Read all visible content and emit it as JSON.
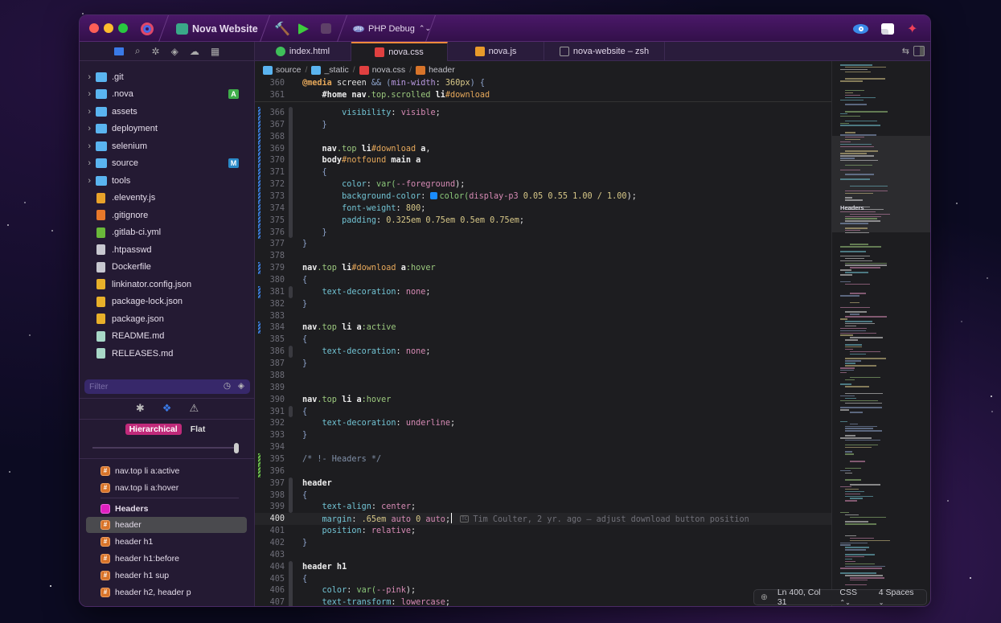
{
  "titlebar": {
    "project": "Nova Website",
    "scheme": "PHP Debug",
    "scheme_badge": "php"
  },
  "tabs": [
    {
      "label": "index.html",
      "icon": "globe-icon",
      "color": "#3fbf5a",
      "active": false
    },
    {
      "label": "nova.css",
      "icon": "css-nova-icon",
      "color": "#e04040",
      "active": true
    },
    {
      "label": "nova.js",
      "icon": "js-icon",
      "color": "#e89a2a",
      "active": false
    },
    {
      "label": "nova-website – zsh",
      "icon": "terminal-icon",
      "color": "#999999",
      "active": false
    }
  ],
  "breadcrumb": [
    "source",
    "_static",
    "nova.css",
    "header"
  ],
  "files": [
    {
      "name": ".git",
      "folder": true,
      "color": "#5ab4f0"
    },
    {
      "name": ".nova",
      "folder": true,
      "color": "#5ab4f0",
      "badge": "A",
      "badge_color": "#3fae4a"
    },
    {
      "name": "assets",
      "folder": true,
      "color": "#5ab4f0"
    },
    {
      "name": "deployment",
      "folder": true,
      "color": "#5ab4f0"
    },
    {
      "name": "selenium",
      "folder": true,
      "color": "#5ab4f0"
    },
    {
      "name": "source",
      "folder": true,
      "color": "#5ab4f0",
      "badge": "M",
      "badge_color": "#2a8ac8"
    },
    {
      "name": "tools",
      "folder": true,
      "color": "#5ab4f0"
    },
    {
      "name": ".eleventy.js",
      "folder": false,
      "color": "#e8a22a"
    },
    {
      "name": ".gitignore",
      "folder": false,
      "color": "#e8782a"
    },
    {
      "name": ".gitlab-ci.yml",
      "folder": false,
      "color": "#6ab83a"
    },
    {
      "name": ".htpasswd",
      "folder": false,
      "color": "#c8c8d0"
    },
    {
      "name": "Dockerfile",
      "folder": false,
      "color": "#c8c8d0"
    },
    {
      "name": "linkinator.config.json",
      "folder": false,
      "color": "#e8b02a"
    },
    {
      "name": "package-lock.json",
      "folder": false,
      "color": "#e8b02a"
    },
    {
      "name": "package.json",
      "folder": false,
      "color": "#e8b02a"
    },
    {
      "name": "README.md",
      "folder": false,
      "color": "#a8d8c8"
    },
    {
      "name": "RELEASES.md",
      "folder": false,
      "color": "#a8d8c8"
    }
  ],
  "filter_placeholder": "Filter",
  "symbols": {
    "mode_options": [
      "Hierarchical",
      "Flat"
    ],
    "selected_mode": "Hierarchical",
    "depth_slider": 1.0,
    "items": [
      {
        "label": "nav.top li a:active",
        "kind": "rule"
      },
      {
        "label": "nav.top li a:hover",
        "kind": "rule"
      },
      {
        "label": "Headers",
        "kind": "mark"
      },
      {
        "label": "header",
        "kind": "rule",
        "selected": true
      },
      {
        "label": "header h1",
        "kind": "rule"
      },
      {
        "label": "header h1:before",
        "kind": "rule"
      },
      {
        "label": "header h1 sup",
        "kind": "rule"
      },
      {
        "label": "header h2, header p",
        "kind": "rule"
      }
    ]
  },
  "code": {
    "sticky": [
      {
        "n": "360",
        "t": [
          [
            "k",
            "@media"
          ],
          [
            "w",
            " screen "
          ],
          [
            "b",
            "&& ("
          ],
          [
            "a",
            "min-width"
          ],
          [
            "w",
            ": "
          ],
          [
            "n",
            "360px"
          ],
          [
            "b",
            ") {"
          ]
        ]
      },
      {
        "n": "361",
        "t": [
          [
            "w",
            "    "
          ],
          [
            "s",
            "#home"
          ],
          [
            "s",
            " nav"
          ],
          [
            "c",
            ".top.scrolled"
          ],
          [
            "s",
            " li"
          ],
          [
            "i",
            "#download"
          ]
        ]
      }
    ],
    "lines": [
      {
        "n": "366",
        "ch": "modified",
        "t": [
          [
            "p",
            "        visibility"
          ],
          [
            "w",
            ": "
          ],
          [
            "v",
            "visible"
          ],
          [
            "w",
            ";"
          ]
        ]
      },
      {
        "n": "367",
        "ch": "modified",
        "t": [
          [
            "b",
            "    }"
          ]
        ]
      },
      {
        "n": "368",
        "ch": "modified",
        "t": []
      },
      {
        "n": "369",
        "ch": "modified",
        "t": [
          [
            "s",
            "    nav"
          ],
          [
            "c",
            ".top"
          ],
          [
            "s",
            " li"
          ],
          [
            "i",
            "#download"
          ],
          [
            "s",
            " a"
          ],
          [
            "w",
            ","
          ]
        ]
      },
      {
        "n": "370",
        "ch": "modified",
        "t": [
          [
            "s",
            "    body"
          ],
          [
            "i",
            "#notfound"
          ],
          [
            "s",
            " main a"
          ]
        ]
      },
      {
        "n": "371",
        "ch": "modified",
        "t": [
          [
            "b",
            "    {"
          ]
        ]
      },
      {
        "n": "372",
        "ch": "modified",
        "t": [
          [
            "p",
            "        color"
          ],
          [
            "w",
            ": "
          ],
          [
            "f",
            "var("
          ],
          [
            "v",
            "--foreground"
          ],
          [
            "w",
            ");"
          ]
        ]
      },
      {
        "n": "373",
        "ch": "modified",
        "t": [
          [
            "p",
            "        background-color"
          ],
          [
            "w",
            ": "
          ],
          [
            "sw",
            "#1a8cff"
          ],
          [
            "f",
            "color("
          ],
          [
            "v",
            "display-p3 "
          ],
          [
            "n",
            "0.05 0.55 1.00 / 1.00"
          ],
          [
            "w",
            ");"
          ]
        ]
      },
      {
        "n": "374",
        "ch": "modified",
        "t": [
          [
            "p",
            "        font-weight"
          ],
          [
            "w",
            ": "
          ],
          [
            "n",
            "800"
          ],
          [
            "w",
            ";"
          ]
        ]
      },
      {
        "n": "375",
        "ch": "modified",
        "t": [
          [
            "p",
            "        padding"
          ],
          [
            "w",
            ": "
          ],
          [
            "n",
            "0.325em 0.75em 0.5em 0.75em"
          ],
          [
            "w",
            ";"
          ]
        ]
      },
      {
        "n": "376",
        "ch": "modified",
        "t": [
          [
            "b",
            "    }"
          ]
        ]
      },
      {
        "n": "377",
        "t": [
          [
            "b",
            "}"
          ]
        ]
      },
      {
        "n": "378",
        "t": []
      },
      {
        "n": "379",
        "ch": "modified",
        "t": [
          [
            "s",
            "nav"
          ],
          [
            "c",
            ".top"
          ],
          [
            "s",
            " li"
          ],
          [
            "i",
            "#download"
          ],
          [
            "s",
            " a"
          ],
          [
            "c",
            ":hover"
          ]
        ]
      },
      {
        "n": "380",
        "t": [
          [
            "b",
            "{"
          ]
        ]
      },
      {
        "n": "381",
        "ch": "modified",
        "t": [
          [
            "p",
            "    text-decoration"
          ],
          [
            "w",
            ": "
          ],
          [
            "v",
            "none"
          ],
          [
            "w",
            ";"
          ]
        ]
      },
      {
        "n": "382",
        "t": [
          [
            "b",
            "}"
          ]
        ]
      },
      {
        "n": "383",
        "t": []
      },
      {
        "n": "384",
        "ch": "modified",
        "t": [
          [
            "s",
            "nav"
          ],
          [
            "c",
            ".top"
          ],
          [
            "s",
            " li a"
          ],
          [
            "c",
            ":active"
          ]
        ]
      },
      {
        "n": "385",
        "t": [
          [
            "b",
            "{"
          ]
        ]
      },
      {
        "n": "386",
        "t": [
          [
            "p",
            "    text-decoration"
          ],
          [
            "w",
            ": "
          ],
          [
            "v",
            "none"
          ],
          [
            "w",
            ";"
          ]
        ]
      },
      {
        "n": "387",
        "t": [
          [
            "b",
            "}"
          ]
        ]
      },
      {
        "n": "388",
        "t": []
      },
      {
        "n": "389",
        "t": []
      },
      {
        "n": "390",
        "t": [
          [
            "s",
            "nav"
          ],
          [
            "c",
            ".top"
          ],
          [
            "s",
            " li a"
          ],
          [
            "c",
            ":hover"
          ]
        ]
      },
      {
        "n": "391",
        "t": [
          [
            "b",
            "{"
          ]
        ]
      },
      {
        "n": "392",
        "t": [
          [
            "p",
            "    text-decoration"
          ],
          [
            "w",
            ": "
          ],
          [
            "v",
            "underline"
          ],
          [
            "w",
            ";"
          ]
        ]
      },
      {
        "n": "393",
        "t": [
          [
            "b",
            "}"
          ]
        ]
      },
      {
        "n": "394",
        "t": []
      },
      {
        "n": "395",
        "ch": "added",
        "t": [
          [
            "m",
            "/* !- Headers */"
          ]
        ]
      },
      {
        "n": "396",
        "ch": "added",
        "t": []
      },
      {
        "n": "397",
        "t": [
          [
            "s",
            "header"
          ]
        ]
      },
      {
        "n": "398",
        "t": [
          [
            "b",
            "{"
          ]
        ]
      },
      {
        "n": "399",
        "t": [
          [
            "p",
            "    text-align"
          ],
          [
            "w",
            ": "
          ],
          [
            "v",
            "center"
          ],
          [
            "w",
            ";"
          ]
        ]
      },
      {
        "n": "400",
        "current": true,
        "t": [
          [
            "p",
            "    margin"
          ],
          [
            "w",
            ": "
          ],
          [
            "n",
            ".65em "
          ],
          [
            "v",
            "auto "
          ],
          [
            "n",
            "0 "
          ],
          [
            "v",
            "auto"
          ],
          [
            "w",
            ";"
          ]
        ]
      },
      {
        "n": "401",
        "t": [
          [
            "p",
            "    position"
          ],
          [
            "w",
            ": "
          ],
          [
            "v",
            "relative"
          ],
          [
            "w",
            ";"
          ]
        ]
      },
      {
        "n": "402",
        "t": [
          [
            "b",
            "}"
          ]
        ]
      },
      {
        "n": "403",
        "t": []
      },
      {
        "n": "404",
        "t": [
          [
            "s",
            "header h1"
          ]
        ]
      },
      {
        "n": "405",
        "t": [
          [
            "b",
            "{"
          ]
        ]
      },
      {
        "n": "406",
        "t": [
          [
            "p",
            "    color"
          ],
          [
            "w",
            ": "
          ],
          [
            "f",
            "var("
          ],
          [
            "v",
            "--pink"
          ],
          [
            "w",
            ");"
          ]
        ]
      },
      {
        "n": "407",
        "t": [
          [
            "p",
            "    text-transform"
          ],
          [
            "w",
            ": "
          ],
          [
            "v",
            "lowercase"
          ],
          [
            "w",
            ";"
          ]
        ]
      }
    ],
    "blame": {
      "initials": "TC",
      "text": "Tim Coulter, 2 yr. ago — adjust download button position"
    }
  },
  "minimap": {
    "section_label": "Headers"
  },
  "status": {
    "position": "Ln 400, Col 31",
    "language": "CSS",
    "indent": "4 Spaces"
  }
}
